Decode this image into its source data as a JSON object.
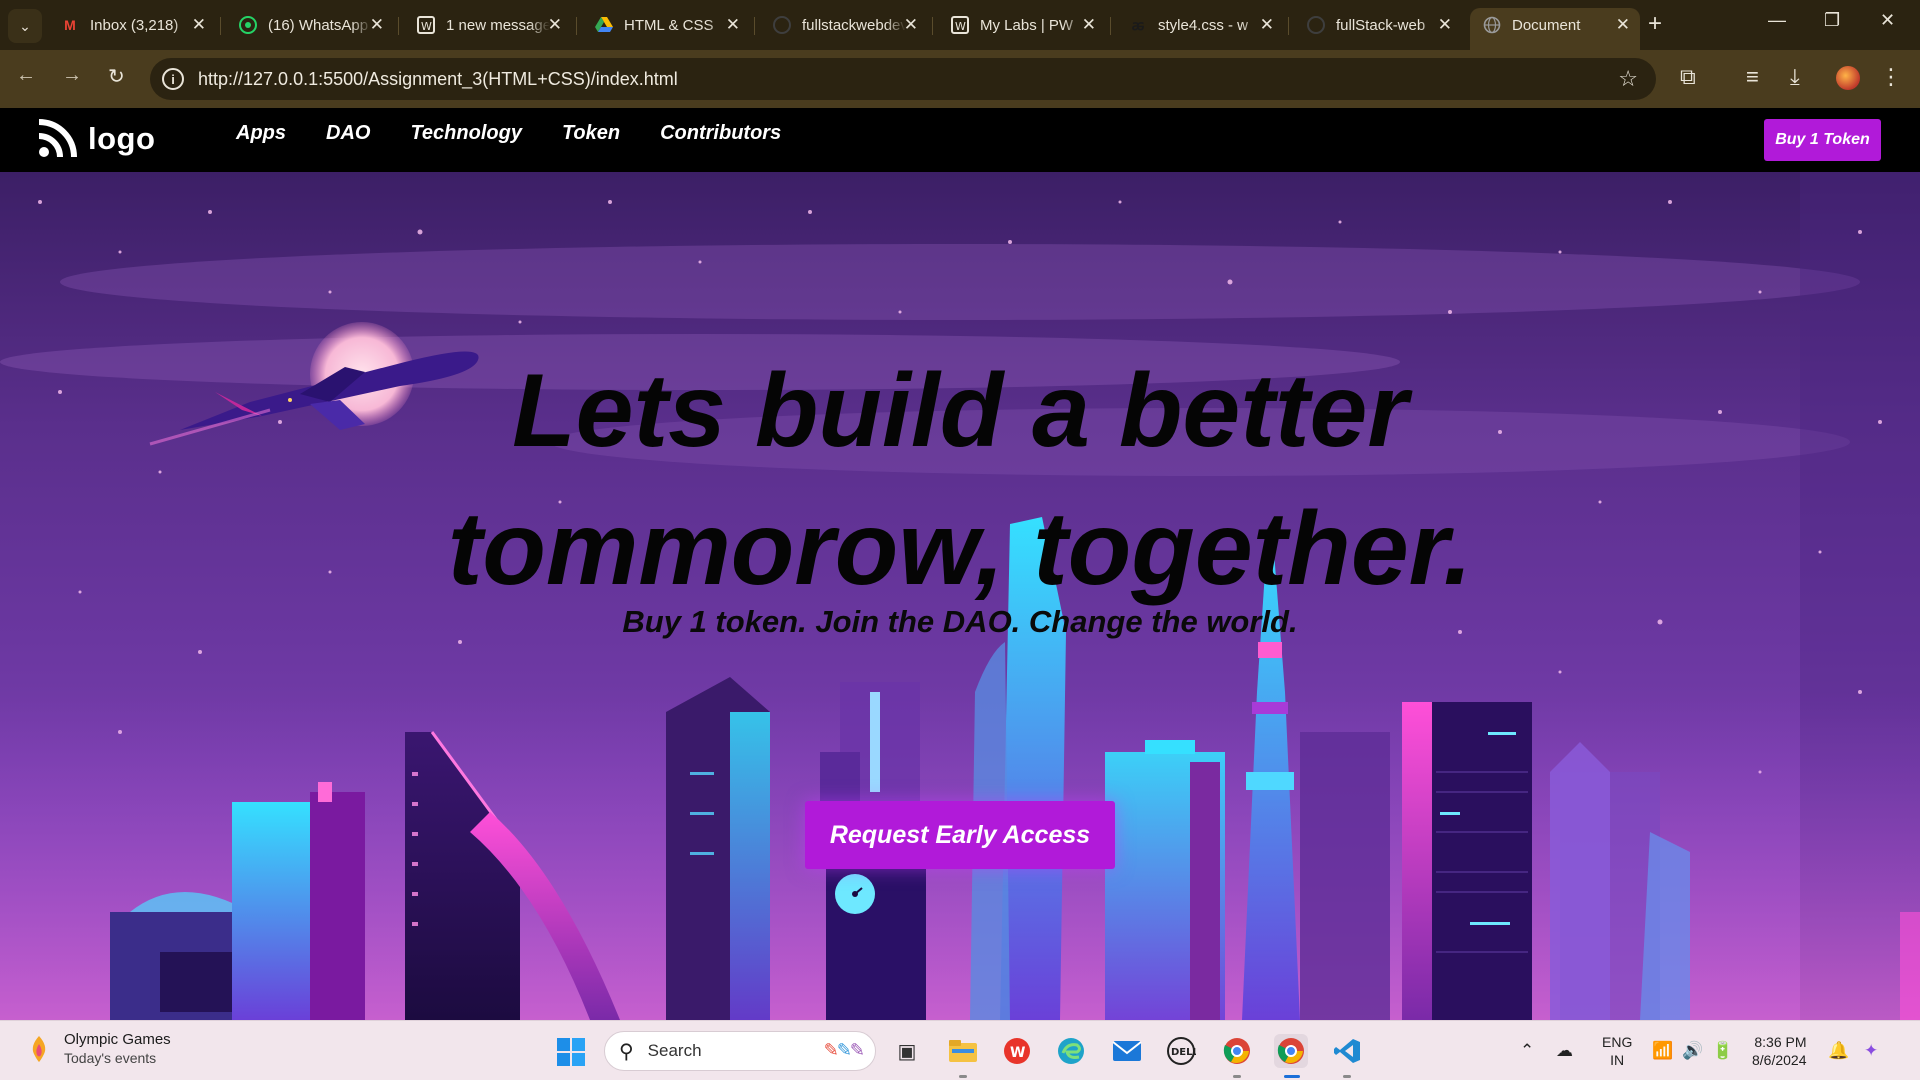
{
  "browser": {
    "tabs": [
      {
        "title": "Inbox (3,218)",
        "favicon": "gmail-icon",
        "color": "#ea4335"
      },
      {
        "title": "(16) WhatsApp",
        "favicon": "whatsapp-icon",
        "color": "#25d366"
      },
      {
        "title": "1 new message",
        "favicon": "wordpress-icon",
        "color": "#e9e4d8"
      },
      {
        "title": "HTML & CSS",
        "favicon": "google-drive-icon",
        "color": "#fbbc04"
      },
      {
        "title": "fullstackwebdev",
        "favicon": "github-icon",
        "color": "#3b3b3b"
      },
      {
        "title": "My Labs | PW",
        "favicon": "wordpress-icon",
        "color": "#e9e4d8"
      },
      {
        "title": "style4.css - w",
        "favicon": "codesandbox-icon",
        "color": "#2a2a2a"
      },
      {
        "title": "fullStack-web",
        "favicon": "github-icon",
        "color": "#3b3b3b"
      },
      {
        "title": "Document",
        "favicon": "globe-icon",
        "color": "#9a9a9a",
        "active": true
      }
    ],
    "url": "http://127.0.0.1:5500/Assignment_3(HTML+CSS)/index.html"
  },
  "site": {
    "logo_text": "logo",
    "nav": [
      "Apps",
      "DAO",
      "Technology",
      "Token",
      "Contributors"
    ],
    "buy_button": "Buy 1 Token",
    "headline_line1": "Lets build a better",
    "headline_line2": "tommorow, together.",
    "subline": "Buy 1 token. Join the DAO. Change the world.",
    "cta": "Request Early Access",
    "accent_color": "#b11ad9"
  },
  "taskbar": {
    "weather_title": "Olympic Games",
    "weather_sub": "Today's events",
    "search_placeholder": "Search",
    "apps": [
      "task-view-icon",
      "file-explorer-icon",
      "wps-office-icon",
      "edge-icon",
      "mail-icon",
      "dell-icon",
      "chrome-icon",
      "chrome-profile-icon",
      "vscode-icon"
    ],
    "lang_line1": "ENG",
    "lang_line2": "IN",
    "time": "8:36 PM",
    "date": "8/6/2024"
  }
}
